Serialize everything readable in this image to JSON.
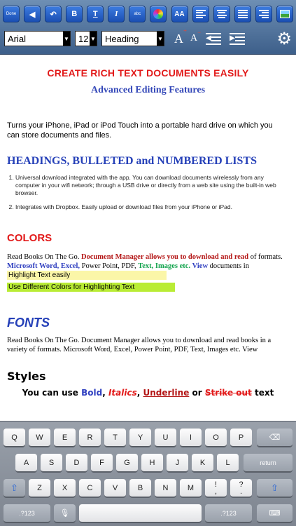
{
  "toolbar": {
    "done_label": "Done",
    "bold_label": "B",
    "underline_label": "T",
    "italic_label": "I",
    "abc_label": "abc",
    "font_size_label": "AA",
    "font_name": "Arial",
    "font_size": "12",
    "paragraph_style": "Heading",
    "grow_label": "A",
    "shrink_label": "A",
    "settings_icon": "gear-icon",
    "accent_color": "#1b4fb3"
  },
  "document": {
    "title": "CREATE RICH TEXT DOCUMENTS EASILY",
    "subtitle": "Advanced Editing Features",
    "intro": "Turns your iPhone, iPad or iPod Touch into a portable hard drive on which you can store documents and files.",
    "lists_heading": "HEADINGS, BULLETED and NUMBERED LISTS",
    "list_items": [
      "Universal download integrated with the app. You can download documents wirelessly from any computer in your wifi network; through a USB drive or directly from a web site using the built-in web browser.",
      "Integrates with Dropbox. Easily upload or download files from your iPhone or iPad."
    ],
    "colors_heading": "COLORS",
    "colors_p1": "Read Books On The Go.",
    "colors_p2": "Document Manager allows you to download and read",
    "colors_p3": "of formats.",
    "colors_p4": "Microsoft Word, Excel,",
    "colors_p5": "Power Point, PDF,",
    "colors_p6": "Text, Images etc.",
    "colors_p7": "View",
    "colors_p8": "documents in",
    "highlight1": "Highlight Text easily",
    "highlight2": "Use Different Colors for Highlighting Text",
    "fonts_heading": "FONTS",
    "fonts_paragraph": "Read Books On The Go. Document Manager allows you to download and read books in a variety of formats. Microsoft Word, Excel, Power Point, PDF, Text, Images etc. View",
    "styles_heading": "Styles",
    "styles_prefix": "You can use",
    "styles_bold": "Bold",
    "styles_italic": "Italics",
    "styles_underline": "Underline",
    "styles_or": "or",
    "styles_strike": "Strike out",
    "styles_suffix": "text"
  },
  "keyboard": {
    "row1": [
      "Q",
      "W",
      "E",
      "R",
      "T",
      "Y",
      "U",
      "I",
      "O",
      "P"
    ],
    "row2": [
      "A",
      "S",
      "D",
      "F",
      "G",
      "H",
      "J",
      "K",
      "L"
    ],
    "row3": [
      "Z",
      "X",
      "C",
      "V",
      "B",
      "N",
      "M",
      "!",
      ",",
      "?"
    ],
    "row3_alt": [
      "",
      "",
      "",
      "",
      "",
      "",
      "",
      "",
      "'",
      "."
    ],
    "return_label": "return",
    "numbers_label": ".?123",
    "shift_icon": "shift-icon",
    "backspace_icon": "backspace-icon",
    "mic_icon": "microphone-icon",
    "hide_keyboard_icon": "keyboard-hide-icon"
  }
}
